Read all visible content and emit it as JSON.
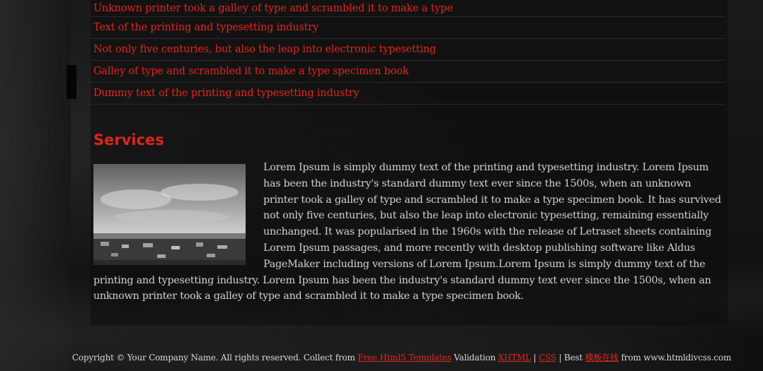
{
  "links": [
    {
      "label": "Unknown printer took a galley of type and scrambled it to make a type"
    },
    {
      "label": "Text of the printing and typesetting industry"
    },
    {
      "label": "Not only five centuries, but also the leap into electronic typesetting"
    },
    {
      "label": "Galley of type and scrambled it to make a type specimen book"
    },
    {
      "label": "Dummy text of the printing and typesetting industry"
    }
  ],
  "services": {
    "title": "Services",
    "body": "Lorem Ipsum is simply dummy text of the printing and typesetting industry. Lorem Ipsum has been the industry's standard dummy text ever since the 1500s, when an unknown printer took a galley of type and scrambled it to make a type specimen book. It has survived not only five centuries, but also the leap into electronic typesetting, remaining essentially unchanged. It was popularised in the 1960s with the release of Letraset sheets containing Lorem Ipsum passages, and more recently with desktop publishing software like Aldus PageMaker including versions of Lorem Ipsum.Lorem Ipsum is simply dummy text of the printing and typesetting industry. Lorem Ipsum has been the industry's standard dummy text ever since the 1500s, when an unknown printer took a galley of type and scrambled it to make a type specimen book."
  },
  "footer": {
    "copyright": "Copyright © Your Company Name. All rights reserved. Collect from ",
    "templates_link": "Free Html5 Templates",
    "validation_text": " Validation ",
    "xhtml_link": "XHTML",
    "sep1": " | ",
    "css_link": "CSS",
    "best_text": " | Best ",
    "cn_link": "模板在线",
    "from_text": " from www.htmldivcss.com"
  },
  "colors": {
    "accent": "#e0261d",
    "text": "#d2d2d2",
    "background": "#101010"
  }
}
